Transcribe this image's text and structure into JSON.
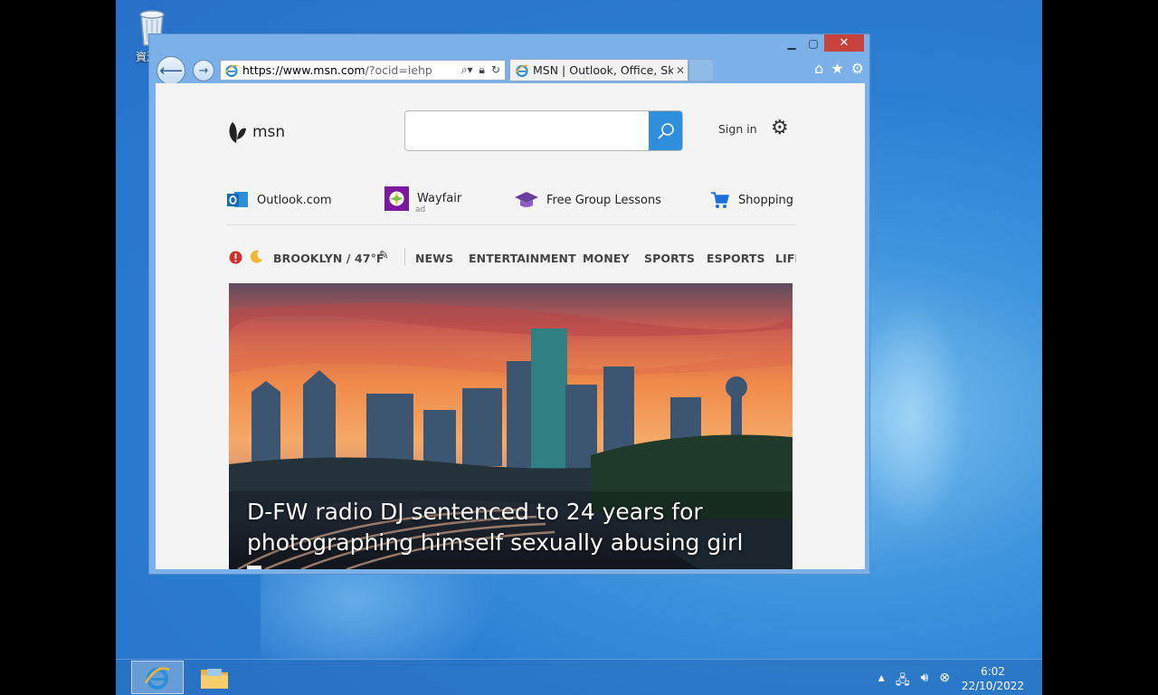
{
  "desktop": {
    "recycle_bin_label": "資源回"
  },
  "window": {
    "caption": {
      "minimize": "▁",
      "maximize": "▢",
      "close": "✕"
    },
    "address": {
      "url_host": "https://www.msn.com",
      "url_rest": "/?ocid=iehp"
    },
    "tab": {
      "title": "MSN | Outlook, Office, Sk...",
      "close": "✕"
    }
  },
  "msn": {
    "logo_text": "msn",
    "search_placeholder": "",
    "sign_in": "Sign in",
    "quick_links": [
      {
        "label": "Outlook.com",
        "icon": "outlook-icon"
      },
      {
        "label": "Wayfair",
        "badge": "ad",
        "icon": "wayfair-icon"
      },
      {
        "label": "Free Group Lessons",
        "icon": "graduation-cap-icon"
      },
      {
        "label": "Shopping",
        "icon": "shopping-cart-icon"
      }
    ],
    "weather": "BROOKLYN / 47°F",
    "nav": [
      "NEWS",
      "ENTERTAINMENT",
      "MONEY",
      "SPORTS",
      "ESPORTS",
      "LIFE"
    ],
    "hero": {
      "headline": "D-FW radio DJ sentenced to 24 years for photographing himself sexually abusing girl"
    }
  },
  "taskbar": {
    "clock_time": "6:02",
    "clock_date": "22/10/2022"
  },
  "colors": {
    "accent": "#2f8fdc",
    "close_button": "#c7423d",
    "alert": "#d0312d"
  }
}
